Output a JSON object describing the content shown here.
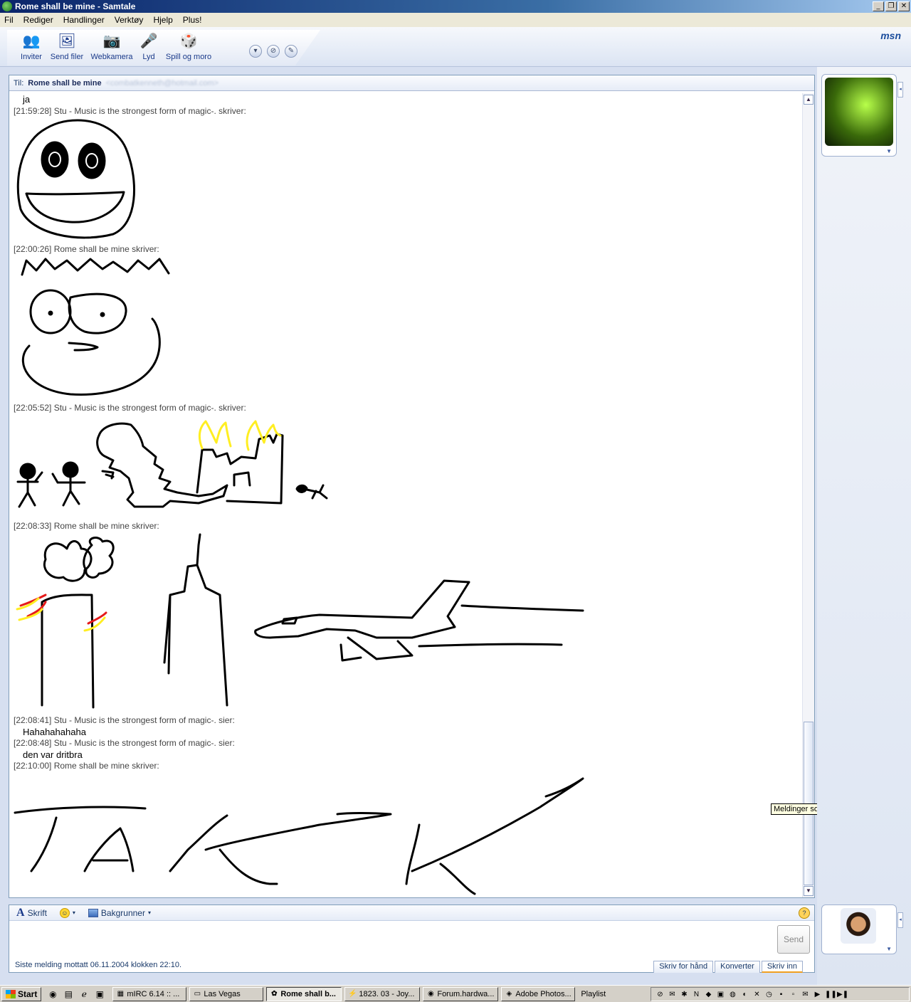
{
  "window": {
    "title": "Rome shall be mine - Samtale",
    "buttons": [
      "_",
      "❐",
      "✕"
    ]
  },
  "menubar": [
    "Fil",
    "Rediger",
    "Handlinger",
    "Verktøy",
    "Hjelp",
    "Plus!"
  ],
  "brand": "msn",
  "toolbar": {
    "invite": "Inviter",
    "send_files": "Send filer",
    "webcam": "Webkamera",
    "audio": "Lyd",
    "games": "Spill og moro"
  },
  "to_bar": {
    "label": "Til:",
    "name": "Rome shall be mine",
    "email": "<combatkenneth@hotmail.com>"
  },
  "messages": {
    "m0_text": "ja",
    "m1_meta": "[21:59:28] Stu - Music is the strongest form of magic-. skriver:",
    "m2_meta": "[22:00:26] Rome shall be mine skriver:",
    "m3_meta": "[22:05:52] Stu - Music is the strongest form of magic-. skriver:",
    "m4_meta": "[22:08:33] Rome shall be mine skriver:",
    "m5_meta": "[22:08:41] Stu - Music is the strongest form of magic-. sier:",
    "m5_text": "Hahahahahaha",
    "m6_meta": "[22:08:48] Stu - Music is the strongest form of magic-. sier:",
    "m6_text": "den var dritbra",
    "m7_meta": "[22:10:00] Rome shall be mine skriver:"
  },
  "tooltip": "Meldinger som er sendt og mottatt",
  "format_bar": {
    "font": "Skrift",
    "backgrounds": "Bakgrunner"
  },
  "compose": {
    "send": "Send",
    "status": "Siste melding mottatt 06.11.2004 klokken 22:10."
  },
  "input_tabs": [
    "Skriv for hånd",
    "Konverter",
    "Skriv inn"
  ],
  "taskbar": {
    "start": "Start",
    "tasks": [
      "mIRC 6.14 :: ...",
      "Las Vegas",
      "Rome shall b...",
      "1823. 03 - Joy...",
      "Forum.hardwa...",
      "Adobe Photos..."
    ],
    "playlist": "Playlist"
  }
}
